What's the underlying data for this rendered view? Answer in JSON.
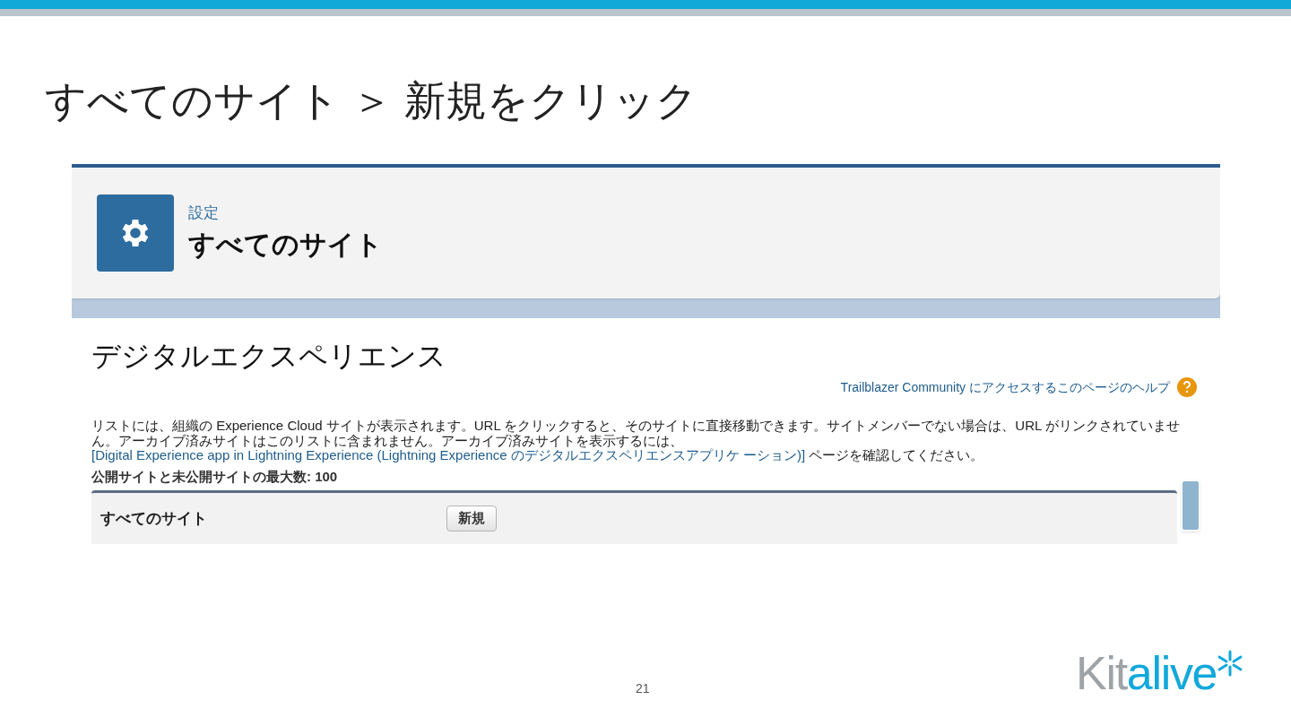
{
  "slide": {
    "title": "すべてのサイト ＞ 新規をクリック",
    "page_number": "21",
    "logo": {
      "part_1": "Kit",
      "part_2": "alive"
    }
  },
  "screenshot": {
    "header": {
      "breadcrumb": "設定",
      "title": "すべてのサイト"
    },
    "page_title": "デジタルエクスペリエンス",
    "help_link": "Trailblazer Community にアクセスするこのページのヘルプ",
    "description": "リストには、組織の Experience Cloud サイトが表示されます。URL をクリックすると、そのサイトに直接移動できます。サイトメンバーでない場合は、URL がリンクされていません。アーカイブ済みサイトはこのリストに含まれません。アーカイブ済みサイトを表示するには、",
    "description_link": "[Digital Experience app in Lightning Experience (Lightning Experience のデジタルエクスペリエンスアプリケ ーション)]",
    "description_end": " ページを確認してください。",
    "limit": "公開サイトと未公開サイトの最大数: 100",
    "list": {
      "title": "すべてのサイト",
      "button": "新規"
    }
  }
}
